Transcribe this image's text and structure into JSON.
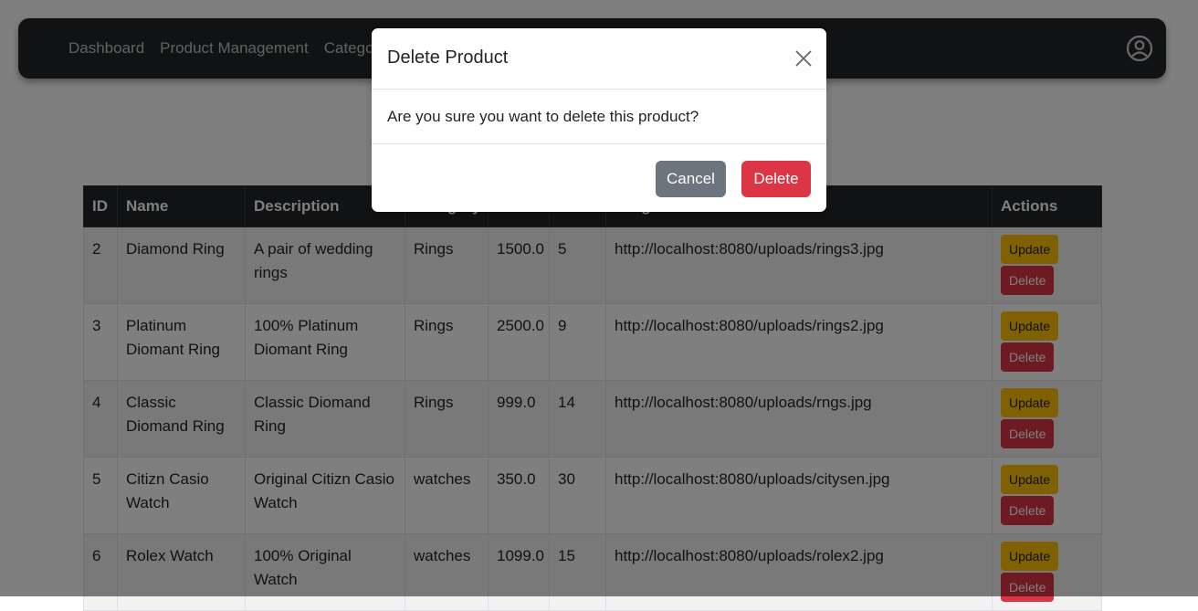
{
  "nav": {
    "items": [
      {
        "label": "Dashboard"
      },
      {
        "label": "Product Management"
      },
      {
        "label": "Catego"
      }
    ]
  },
  "table": {
    "headers": [
      "ID",
      "Name",
      "Description",
      "Category",
      "Price",
      "Stock",
      "Image",
      "Actions"
    ],
    "rows": [
      {
        "id": "2",
        "name": "Diamond Ring",
        "description": "A pair of wedding rings",
        "category": "Rings",
        "price": "1500.0",
        "stock": "5",
        "image": "http://localhost:8080/uploads/rings3.jpg"
      },
      {
        "id": "3",
        "name": "Platinum Diomant Ring",
        "description": "100% Platinum Diomant Ring",
        "category": "Rings",
        "price": "2500.0",
        "stock": "9",
        "image": "http://localhost:8080/uploads/rings2.jpg"
      },
      {
        "id": "4",
        "name": "Classic Diomand Ring",
        "description": "Classic Diomand Ring",
        "category": "Rings",
        "price": "999.0",
        "stock": "14",
        "image": "http://localhost:8080/uploads/rngs.jpg"
      },
      {
        "id": "5",
        "name": "Citizn Casio Watch",
        "description": "Original Citizn Casio Watch",
        "category": "watches",
        "price": "350.0",
        "stock": "30",
        "image": "http://localhost:8080/uploads/citysen.jpg"
      },
      {
        "id": "6",
        "name": "Rolex Watch",
        "description": "100% Original Watch",
        "category": "watches",
        "price": "1099.0",
        "stock": "15",
        "image": "http://localhost:8080/uploads/rolex2.jpg"
      }
    ],
    "update_label": "Update",
    "delete_label": "Delete"
  },
  "modal": {
    "title": "Delete Product",
    "message": "Are you sure you want to delete this product?",
    "cancel_label": "Cancel",
    "confirm_label": "Delete"
  },
  "icons": {
    "user": "user-circle-icon",
    "close": "close-icon"
  },
  "colors": {
    "navbar": "#212529",
    "update": "#ffc107",
    "danger": "#dc3545",
    "secondary": "#6c757d"
  }
}
